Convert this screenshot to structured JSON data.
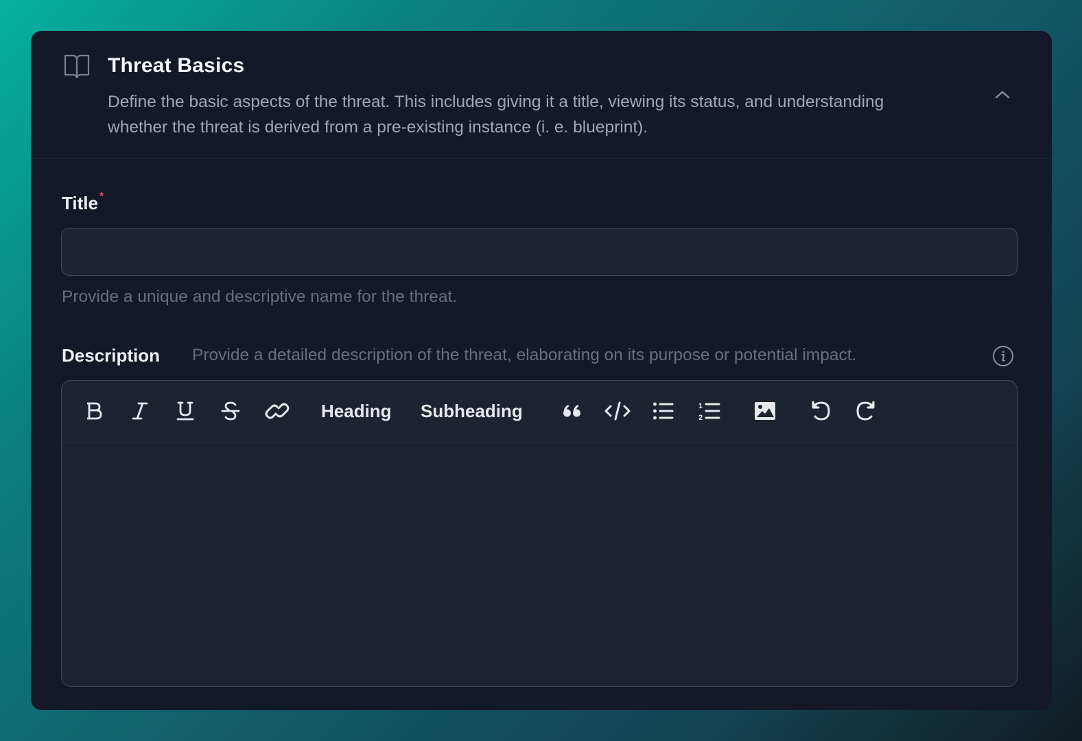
{
  "section": {
    "icon": "book-open-icon",
    "title": "Threat Basics",
    "description": "Define the basic aspects of the threat. This includes giving it a title, viewing its status, and understanding whether the threat is derived from a pre-existing instance (i. e. blueprint).",
    "collapse_icon": "chevron-up-icon"
  },
  "title_field": {
    "label": "Title",
    "required_marker": "*",
    "value": "",
    "placeholder": "",
    "help": "Provide a unique and descriptive name for the threat."
  },
  "description_field": {
    "label": "Description",
    "help": "Provide a detailed description of the threat, elaborating on its purpose or potential impact.",
    "info_icon": "info-circle-icon",
    "value": "",
    "toolbar": {
      "bold": "bold-icon",
      "italic": "italic-icon",
      "underline": "underline-icon",
      "strikethrough": "strikethrough-icon",
      "link": "link-icon",
      "heading": "Heading",
      "subheading": "Subheading",
      "blockquote": "quote-icon",
      "code": "code-icon",
      "bullet_list": "bullet-list-icon",
      "ordered_list": "ordered-list-icon",
      "image": "image-icon",
      "undo": "undo-icon",
      "redo": "redo-icon"
    }
  },
  "colors": {
    "card_bg": "#131928",
    "input_bg": "#1e2331",
    "required": "#e5566b",
    "help_text": "#686e7c"
  }
}
